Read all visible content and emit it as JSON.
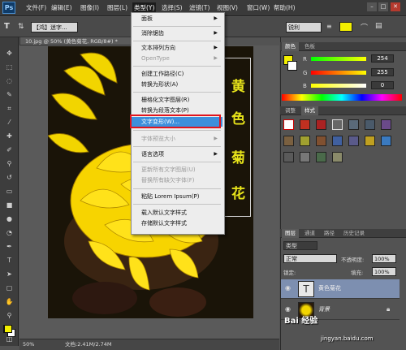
{
  "app": {
    "logo": "Ps"
  },
  "menubar": {
    "items": [
      "文件(F)",
      "编辑(E)",
      "图像(I)",
      "图层(L)",
      "类型(Y)",
      "选择(S)",
      "滤镜(T)",
      "视图(V)",
      "窗口(W)",
      "帮助(H)"
    ],
    "active_index": 4
  },
  "options_bar": {
    "font_family": "【鸿】迷字...",
    "antialias": "锐利",
    "colors": {
      "text_color": "#f3ef00"
    }
  },
  "document": {
    "tab_title": "10.jpg @ 50% (黄色菊花, RGB/8#) *",
    "zoom": "50%",
    "doc_size": "文档:2.41M/2.74M",
    "vertical_text": [
      "黄",
      "色",
      "菊",
      "花"
    ]
  },
  "type_menu": {
    "items": [
      {
        "label": "面板",
        "disabled": false,
        "submenu": true,
        "highlighted": false
      },
      {
        "label": "消除锯齿",
        "disabled": false,
        "submenu": true,
        "highlighted": false
      },
      {
        "label": "文本排列方向",
        "disabled": false,
        "submenu": true,
        "highlighted": false
      },
      {
        "label": "OpenType",
        "disabled": true,
        "submenu": true,
        "highlighted": false
      },
      {
        "label": "创建工作路径(C)",
        "disabled": false,
        "submenu": false,
        "highlighted": false
      },
      {
        "label": "转换为形状(A)",
        "disabled": false,
        "submenu": false,
        "highlighted": false
      },
      {
        "label": "栅格化文字图层(R)",
        "disabled": false,
        "submenu": false,
        "highlighted": false
      },
      {
        "label": "转换为段落文本(P)",
        "disabled": false,
        "submenu": false,
        "highlighted": false
      },
      {
        "label": "文字变形(W)...",
        "disabled": false,
        "submenu": false,
        "highlighted": true
      },
      {
        "label": "字体预览大小",
        "disabled": true,
        "submenu": true,
        "highlighted": false
      },
      {
        "label": "语言选项",
        "disabled": false,
        "submenu": true,
        "highlighted": false
      },
      {
        "label": "更新所有文字图层(U)",
        "disabled": true,
        "submenu": false,
        "highlighted": false
      },
      {
        "label": "替换所有缺欠字体(F)",
        "disabled": true,
        "submenu": false,
        "highlighted": false
      },
      {
        "label": "粘贴 Lorem Ipsum(P)",
        "disabled": false,
        "submenu": false,
        "highlighted": false
      },
      {
        "label": "载入默认文字样式",
        "disabled": false,
        "submenu": false,
        "highlighted": false
      },
      {
        "label": "存储默认文字样式",
        "disabled": false,
        "submenu": false,
        "highlighted": false
      }
    ]
  },
  "color_panel": {
    "tabs": [
      "颜色",
      "色板"
    ],
    "r_label": "R",
    "g_label": "G",
    "b_label": "B",
    "r": "254",
    "g": "255",
    "b": "0",
    "r_level": 0.996,
    "g_level": 1.0,
    "b_level": 0.0
  },
  "styles_panel": {
    "tabs": [
      "调整",
      "样式"
    ]
  },
  "layers_panel": {
    "tabs": [
      "图层",
      "通道",
      "路径",
      "历史记录"
    ],
    "kind_label": "类型",
    "blend_mode": "正常",
    "opacity_label": "不透明度:",
    "opacity": "100%",
    "lock_label": "锁定:",
    "fill_label": "填充:",
    "fill": "100%",
    "layers": [
      {
        "name": "黄色菊花",
        "type": "text",
        "thumb": "T"
      },
      {
        "name": "背景",
        "type": "image",
        "thumb": ""
      }
    ]
  },
  "watermark": {
    "text": "Bai 经验",
    "url": "jingyan.baidu.com"
  }
}
